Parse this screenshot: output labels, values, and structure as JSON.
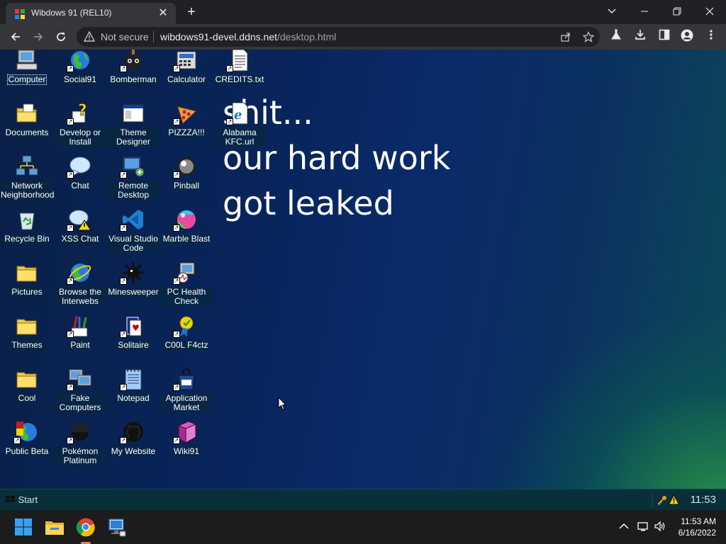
{
  "browser": {
    "tab_title": "Wibdows 91 (REL10)",
    "close_glyph": "✕",
    "new_tab_glyph": "+",
    "not_secure": "Not secure",
    "url_host": "wibdows91-devel.ddns.net",
    "url_path": "/desktop.html"
  },
  "graffiti": {
    "line1": "shit...",
    "line2": "our hard work",
    "line3": "got leaked"
  },
  "desktop_icons": [
    {
      "label": "Computer",
      "icon": "computer-icon"
    },
    {
      "label": "Social91",
      "icon": "globe-icon"
    },
    {
      "label": "Bomberman",
      "icon": "bomberman-icon"
    },
    {
      "label": "Calculator",
      "icon": "calculator-icon"
    },
    {
      "label": "CREDITS.txt",
      "icon": "text-file-icon"
    },
    {
      "label": "Documents",
      "icon": "documents-folder-icon"
    },
    {
      "label": "Develop or Install",
      "icon": "help-icon"
    },
    {
      "label": "Theme Designer",
      "icon": "window-icon"
    },
    {
      "label": "PIZZZA!!!",
      "icon": "pizza-icon"
    },
    {
      "label": "Alabama KFC.url",
      "icon": "internet-shortcut-icon"
    },
    {
      "label": "Network Neighborhood",
      "icon": "network-icon"
    },
    {
      "label": "Chat",
      "icon": "chat-bubble-icon"
    },
    {
      "label": "Remote Desktop",
      "icon": "remote-desktop-icon"
    },
    {
      "label": "Pinball",
      "icon": "pinball-icon"
    },
    {
      "label": "Recycle Bin",
      "icon": "recycle-bin-icon"
    },
    {
      "label": "XSS Chat",
      "icon": "warning-chat-icon"
    },
    {
      "label": "Visual Studio Code",
      "icon": "vscode-icon"
    },
    {
      "label": "Marble Blast",
      "icon": "marble-icon"
    },
    {
      "label": "Pictures",
      "icon": "folder-icon"
    },
    {
      "label": "Browse the Interwebs",
      "icon": "internet-explorer-icon"
    },
    {
      "label": "Minesweeper",
      "icon": "mine-icon"
    },
    {
      "label": "PC Health Check",
      "icon": "health-check-icon"
    },
    {
      "label": "Themes",
      "icon": "folder-icon"
    },
    {
      "label": "Paint",
      "icon": "paint-icon"
    },
    {
      "label": "Solitaire",
      "icon": "cards-icon"
    },
    {
      "label": "C00L F4ctz",
      "icon": "award-icon"
    },
    {
      "label": "Cool",
      "icon": "folder-icon"
    },
    {
      "label": "Fake Computers",
      "icon": "fake-computers-icon"
    },
    {
      "label": "Notepad",
      "icon": "notepad-icon"
    },
    {
      "label": "Application Market",
      "icon": "shopping-bag-icon"
    },
    {
      "label": "Public Beta",
      "icon": "beta-globe-icon"
    },
    {
      "label": "Pokémon Platinum",
      "icon": "pokemon-icon"
    },
    {
      "label": "My Website",
      "icon": "github-icon"
    },
    {
      "label": "Wiki91",
      "icon": "book-icon"
    }
  ],
  "wibdows_taskbar": {
    "start": "Start",
    "time": "11:53"
  },
  "os_taskbar": {
    "time": "11:53 AM",
    "date": "6/16/2022"
  },
  "colors": {
    "accent_taskbar": "#09303a",
    "desktop_blue": "#08245a",
    "desktop_green": "#2a9646"
  }
}
